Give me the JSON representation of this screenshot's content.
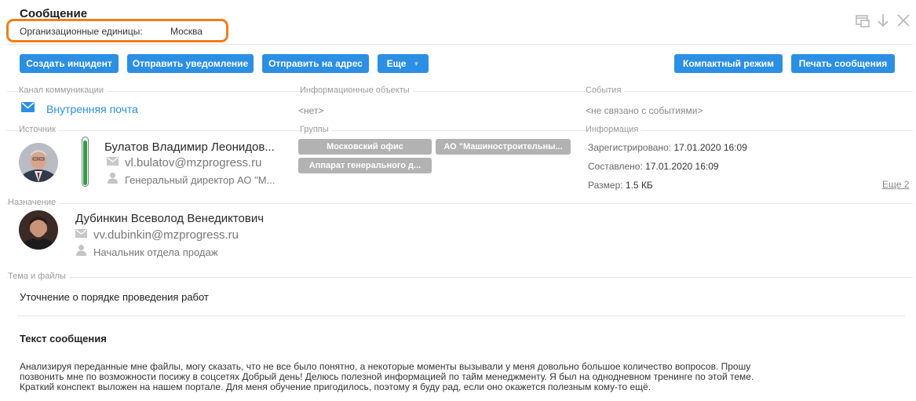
{
  "header": {
    "title": "Сообщение",
    "org_label": "Организационные единицы:",
    "org_value": "Москва"
  },
  "top_icons": [
    "window-icon",
    "download-arrow-icon",
    "close-icon"
  ],
  "toolbar": {
    "create_incident": "Создать инцидент",
    "send_notification": "Отправить уведомление",
    "send_to_address": "Отправить на адрес",
    "more": "Еще",
    "compact_mode": "Компактный режим",
    "print_message": "Печать сообщения"
  },
  "sections": {
    "channel_label": "Канал коммуникации",
    "channel_value": "Внутренняя почта",
    "info_objects_label": "Информационные объекты",
    "info_objects_value": "<нет>",
    "events_label": "События",
    "events_value": "<не связано с событиями>",
    "source_label": "Источник",
    "groups_label": "Группы",
    "information_label": "Информация",
    "destination_label": "Назначение",
    "subject_label": "Тема и файлы"
  },
  "source": {
    "name": "Булатов Владимир Леонидов...",
    "email": "vl.bulatov@mzprogress.ru",
    "position": "Генеральный директор АО \"М...",
    "indicator_level": 0.95
  },
  "groups": [
    "Московский офис",
    "АО \"Машиностроительны...",
    "Аппарат генерального д..."
  ],
  "information": {
    "registered_label": "Зарегистрировано:",
    "registered_value": "17.01.2020 16:09",
    "composed_label": "Составлено:",
    "composed_value": "17.01.2020 16:09",
    "size_label": "Размер:",
    "size_value": "1.5 КБ",
    "more_link": "Еще 2"
  },
  "destination": {
    "name": "Дубинкин Всеволод Венедиктович",
    "email": "vv.dubinkin@mzprogress.ru",
    "position": "Начальник отдела продаж"
  },
  "subject": "Уточнение о порядке проведения работ",
  "message": {
    "title": "Текст сообщения",
    "line1": "Анализируя переданные мне файлы, могу сказать, что не все было понятно, а некоторые моменты вызывали у меня довольно большое количество вопросов. Прошу",
    "line2": "позвонить мне по возможности посижу в соцсетях Добрый день! Делюсь полезной информацией по тайм менеджменту. Я был на однодневном тренинге по этой теме.",
    "line3": "Краткий конспект выложен на нашем портале. Для меня обучение пригодилось, поэтому я буду рад, если оно окажется полезным кому-то ещё."
  },
  "colors": {
    "accent": "#2b8fe3",
    "highlight": "#f07d1e",
    "tag": "#b2b2b2",
    "indicator": "#2ea043"
  }
}
